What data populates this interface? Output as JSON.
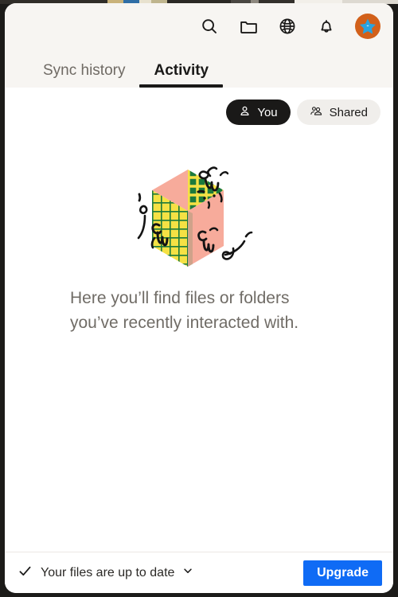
{
  "window": {
    "background_color": "#ffffff",
    "header_color": "#f7f5f2"
  },
  "desktop_strip": {
    "segments": [
      "#3a3733",
      "#c9b27a",
      "#2f6ea6",
      "#e8e2cf",
      "#bfb58e",
      "#2b2925",
      "#33302c",
      "#4a4742",
      "#f2efe9",
      "#ddd9d1",
      "#f7f5f2"
    ]
  },
  "toolbar": {
    "icons": [
      {
        "name": "search-icon",
        "label": "Search"
      },
      {
        "name": "folder-icon",
        "label": "Files"
      },
      {
        "name": "globe-icon",
        "label": "Web"
      },
      {
        "name": "bell-icon",
        "label": "Notifications"
      }
    ],
    "avatar": {
      "name": "avatar",
      "background_color": "#d2601a",
      "star_color": "#29a3e0"
    }
  },
  "tabs": [
    {
      "label": "Sync history",
      "active": false
    },
    {
      "label": "Activity",
      "active": true
    }
  ],
  "filters": [
    {
      "label": "You",
      "icon": "person-icon",
      "selected": true
    },
    {
      "label": "Shared",
      "icon": "people-icon",
      "selected": false
    }
  ],
  "empty_state": {
    "illustration_name": "cube-doodle-illustration",
    "message": "Here you’ll find files or folders you’ve recently interacted with.",
    "colors": {
      "pink": "#f7ab9b",
      "yellow": "#f5e144",
      "green": "#1c7a3c",
      "ink": "#141414"
    }
  },
  "status_bar": {
    "check_icon": "check-icon",
    "sync_label": "Your files are up to date",
    "chevron_icon": "chevron-down-icon",
    "upgrade_label": "Upgrade",
    "upgrade_color": "#0f6bf5"
  }
}
